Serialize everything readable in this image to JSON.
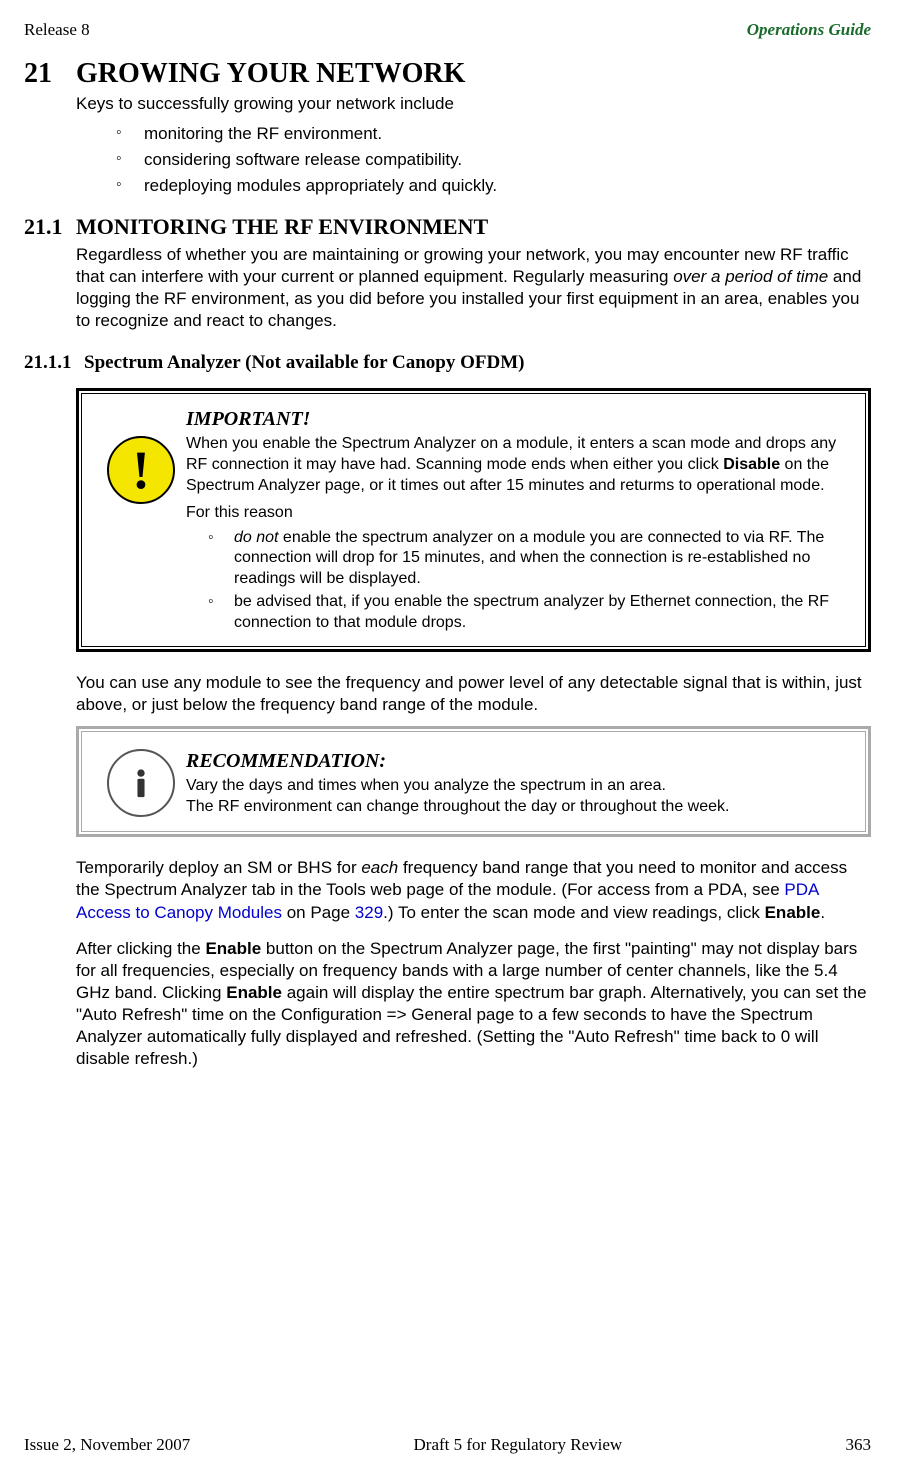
{
  "header": {
    "left": "Release 8",
    "right": "Operations Guide"
  },
  "sections": {
    "h1_num": "21",
    "h1_title": "GROWING YOUR NETWORK",
    "intro": "Keys to successfully growing your network include",
    "intro_bullets": [
      "monitoring the RF environment.",
      "considering software release compatibility.",
      "redeploying modules appropriately and quickly."
    ],
    "h2_num": "21.1",
    "h2_title": "MONITORING THE RF ENVIRONMENT",
    "h2_body_pre": "Regardless of whether you are maintaining or growing your network, you may encounter new RF traffic that can interfere with your current or planned equipment. Regularly measuring ",
    "h2_body_em": "over a period of time",
    "h2_body_post": " and logging the RF environment, as you did before you installed your first equipment in an area, enables you to recognize and react to changes.",
    "h3_num": "21.1.1",
    "h3_title": "Spectrum Analyzer  (Not available for Canopy OFDM)"
  },
  "important": {
    "title": "IMPORTANT!",
    "p1_pre": "When you enable the Spectrum Analyzer on a module, it enters a scan mode and drops any RF connection it may have had. Scanning mode ends when either you click ",
    "p1_b": "Disable",
    "p1_post": " on the Spectrum Analyzer page, or it times out after 15 minutes and returms to operational mode.",
    "p2": "For this reason",
    "b1_em": "do not",
    "b1_post": " enable the spectrum analyzer on a module you are connected to via RF. The connection will drop for 15 minutes, and when the connection is re-established no readings will be displayed.",
    "b2": "be advised that, if you enable the spectrum analyzer by Ethernet connection, the RF connection to that module drops."
  },
  "mid_para": "You can use any module to see the frequency and power level of any detectable signal that is within, just above, or just below the frequency band range of the module.",
  "recommendation": {
    "title": "RECOMMENDATION:",
    "l1": "Vary the days and times when you analyze the spectrum in an area.",
    "l2": "The RF environment can change throughout the day or throughout the week."
  },
  "p3": {
    "pre": "Temporarily deploy an SM or BHS for ",
    "em": "each",
    "mid1": " frequency band range that you need to monitor and access the Spectrum Analyzer tab in the Tools web page of the module. (For access from a PDA, see ",
    "link": "PDA Access to Canopy Modules",
    "mid2": " on Page ",
    "link2": "329",
    "mid3": ".) To enter the scan mode and view readings, click ",
    "b": "Enable",
    "post": "."
  },
  "p4": {
    "pre": "After clicking the ",
    "b1": "Enable",
    "mid1": " button on the Spectrum Analyzer page, the first \"painting\" may not display bars for all frequencies, especially on frequency bands with a large number of center channels, like the 5.4 GHz band. Clicking ",
    "b2": "Enable",
    "mid2": " again will display the entire spectrum bar graph. Alternatively, you can set the \"Auto Refresh\" time on the Configuration => General page to a few seconds to have the Spectrum Analyzer automatically fully displayed and refreshed. (Setting the \"Auto Refresh\" time back to 0 will disable refresh.)"
  },
  "footer": {
    "left": "Issue 2, November 2007",
    "center": "Draft 5 for Regulatory Review",
    "right": "363"
  }
}
